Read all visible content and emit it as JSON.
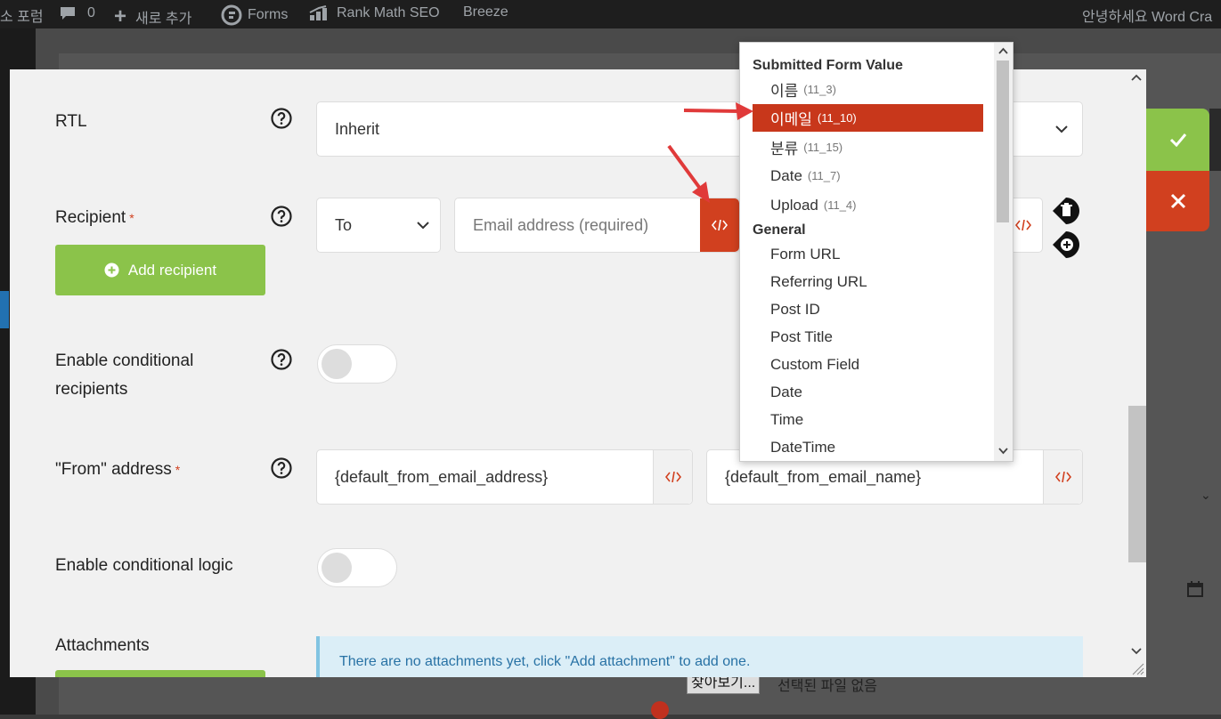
{
  "adminbar": {
    "forum": "소 포럼",
    "comments": "0",
    "new": "새로 추가",
    "forms": "Forms",
    "rankmath": "Rank Math SEO",
    "breeze": "Breeze",
    "greeting": "안녕하세요 Word Cra"
  },
  "background": {
    "browse": "찾아보기...",
    "nofile": "선택된 파일 없음"
  },
  "form": {
    "rtl": {
      "label": "RTL",
      "value": "Inherit"
    },
    "recipient": {
      "label": "Recipient",
      "required": "*",
      "type_value": "To",
      "email_placeholder": "Email address (required)",
      "add_button": "Add recipient"
    },
    "conditional_recipients": {
      "label_line1": "Enable conditional",
      "label_line2": "recipients",
      "enabled": false
    },
    "from": {
      "label": "\"From\" address",
      "required": "*",
      "email": "{default_from_email_address}",
      "name": "{default_from_email_name}"
    },
    "conditional_logic": {
      "label": "Enable conditional logic",
      "enabled": false
    },
    "attachments": {
      "label": "Attachments",
      "notice": "There are no attachments yet, click \"Add attachment\" to add one."
    }
  },
  "dropdown": {
    "group1": "Submitted Form Value",
    "fields": [
      {
        "name": "이름",
        "code": "(11_3)"
      },
      {
        "name": "이메일",
        "code": "(11_10)",
        "selected": true
      },
      {
        "name": "분류",
        "code": "(11_15)"
      },
      {
        "name": "Date",
        "code": "(11_7)"
      },
      {
        "name": "Upload",
        "code": "(11_4)"
      }
    ],
    "group2": "General",
    "general": [
      "Form URL",
      "Referring URL",
      "Post ID",
      "Post Title",
      "Custom Field",
      "Date",
      "Time",
      "DateTime"
    ]
  },
  "colors": {
    "accent_red": "#d1401f",
    "green": "#8bc34a",
    "selected": "#c8371b"
  }
}
